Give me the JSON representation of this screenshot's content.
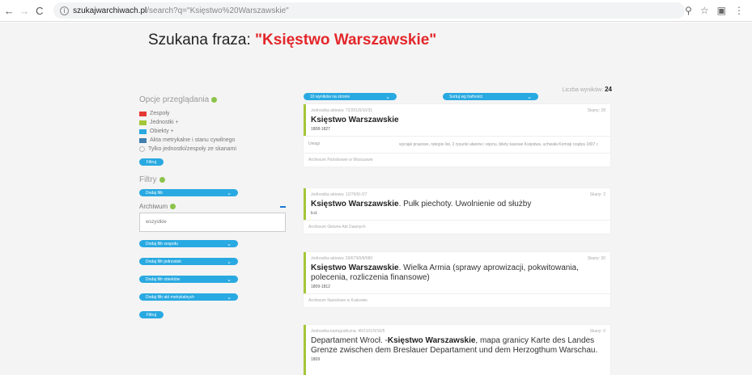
{
  "browser": {
    "back": "←",
    "forward": "→",
    "reload": "C",
    "url_host": "szukajwarchiwach.pl",
    "url_path": "/search?q=\"Księstwo%20Warszawskie\"",
    "icons": [
      "zoom-icon",
      "star-icon",
      "extension-icon",
      "menu-icon"
    ]
  },
  "header": {
    "label": "Szukana fraza:",
    "phrase": "\"Księstwo Warszawskie\""
  },
  "results_count": {
    "label": "Liczba wyników:",
    "value": "24"
  },
  "sidebar": {
    "options_title": "Opcje przeglądania",
    "legend": [
      {
        "label": "Zespoły",
        "color": "#e53935"
      },
      {
        "label": "Jednostki +",
        "color": "#a4c639"
      },
      {
        "label": "Obiekty +",
        "color": "#29a9e1"
      },
      {
        "label": "Akta metrykalne i stanu cywilnego",
        "color": "#3f7fae"
      }
    ],
    "scans_only": "Tylko jednostki/zespoły ze skanami",
    "filter_button": "Filtruj",
    "filters_title": "Filtry",
    "add_filter": "Dodaj filtr",
    "archive_label": "Archiwum",
    "archive_value": "wszystkie",
    "add_filter_series": "Dodaj filtr zespołu",
    "add_filter_units": "Dodaj filtr jednostek",
    "add_filter_objects": "Dodaj filtr obiektów",
    "add_filter_registers": "Dodaj filtr akt metrykalnych",
    "filter_button_bottom": "Filtruj"
  },
  "controls": {
    "per_page": "10 wyników na stronie",
    "sort": "Sortuj wg trafności"
  },
  "results": [
    {
      "meta": "Jednostka aktowa: 72/201/0/10/31",
      "scans": "Skany: 28",
      "title_bold": "Księstwo Warszawskie",
      "title_rest": "",
      "dates": "1808-1827",
      "uwagi_label": "Uwagi",
      "uwagi_text": "wyciąki prasowe, rękopis list, 2 rysunki ułanów i rejonu, bilety kasowe Księstwa, uchwała Komisji rządza 1807 r.",
      "archive": "Archiwum Państwowe w Warszawie"
    },
    {
      "meta": "Jednostka aktowa: 1/279/0/-/27",
      "scans": "Skany: 2",
      "title_bold": "Księstwo Warszawskie",
      "title_rest": ". Pułk piechoty. Uwolnienie od służby",
      "dates": "b.d.",
      "archive": "Archiwum Główne Akt Dawnych"
    },
    {
      "meta": "Jednostka aktowa: 29/679/0/8/680",
      "scans": "Skany: 30",
      "title_bold": "Księstwo Warszawskie",
      "title_rest": ". Wielka Armia (sprawy aprowizacji, pokwitowania, polecenia, rozliczenia finansowe)",
      "dates": "1809-1812",
      "archive": "Archiwum Narodowe w Krakowie"
    },
    {
      "meta": "Jednostka kartograficzna: 45/1101/0/16/5",
      "scans": "Skany: 0",
      "title_pre": "Departament Wrocł. -",
      "title_bold": "Księstwo Warszawskie",
      "title_rest": ", mapa granicy Karte des Landes Grenze zwischen dem Breslauer Departament und dem Herzogthum Warschau.",
      "dates": "1809"
    }
  ]
}
